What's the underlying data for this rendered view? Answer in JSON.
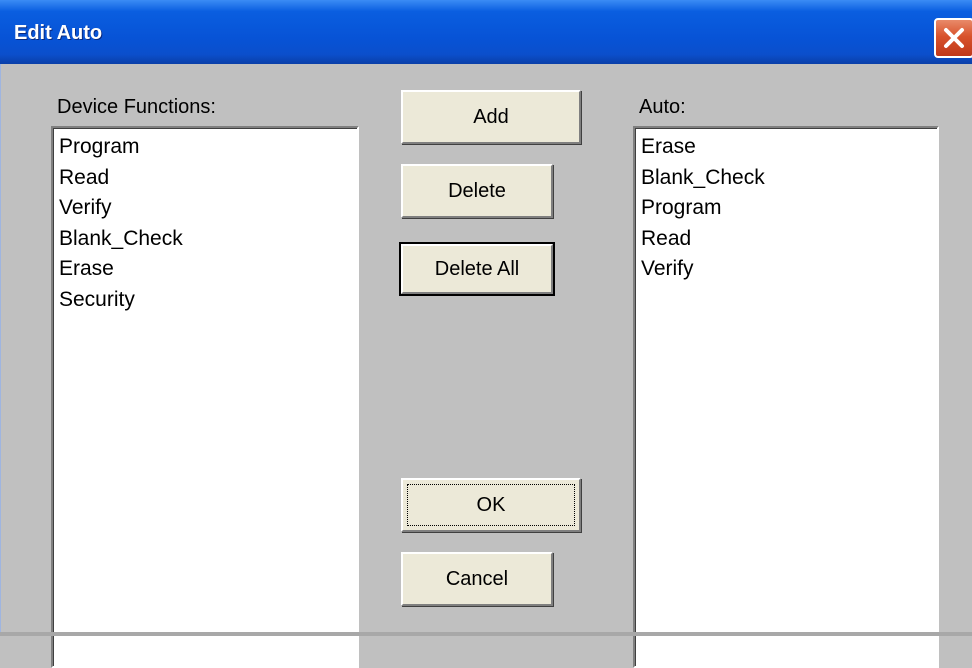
{
  "window": {
    "title": "Edit Auto",
    "close_icon": "close-icon"
  },
  "device_functions": {
    "label": "Device Functions:",
    "items": [
      "Program",
      "Read",
      "Verify",
      "Blank_Check",
      "Erase",
      "Security"
    ]
  },
  "auto": {
    "label": "Auto:",
    "items": [
      "Erase",
      "Blank_Check",
      "Program",
      "Read",
      "Verify"
    ]
  },
  "buttons": {
    "add": "Add",
    "delete": "Delete",
    "delete_all": "Delete All",
    "ok": "OK",
    "cancel": "Cancel"
  },
  "colors": {
    "titlebar": "#0753d6",
    "dialog_bg": "#c0c0c0",
    "button_face": "#ece9d8",
    "close": "#d8532c"
  }
}
